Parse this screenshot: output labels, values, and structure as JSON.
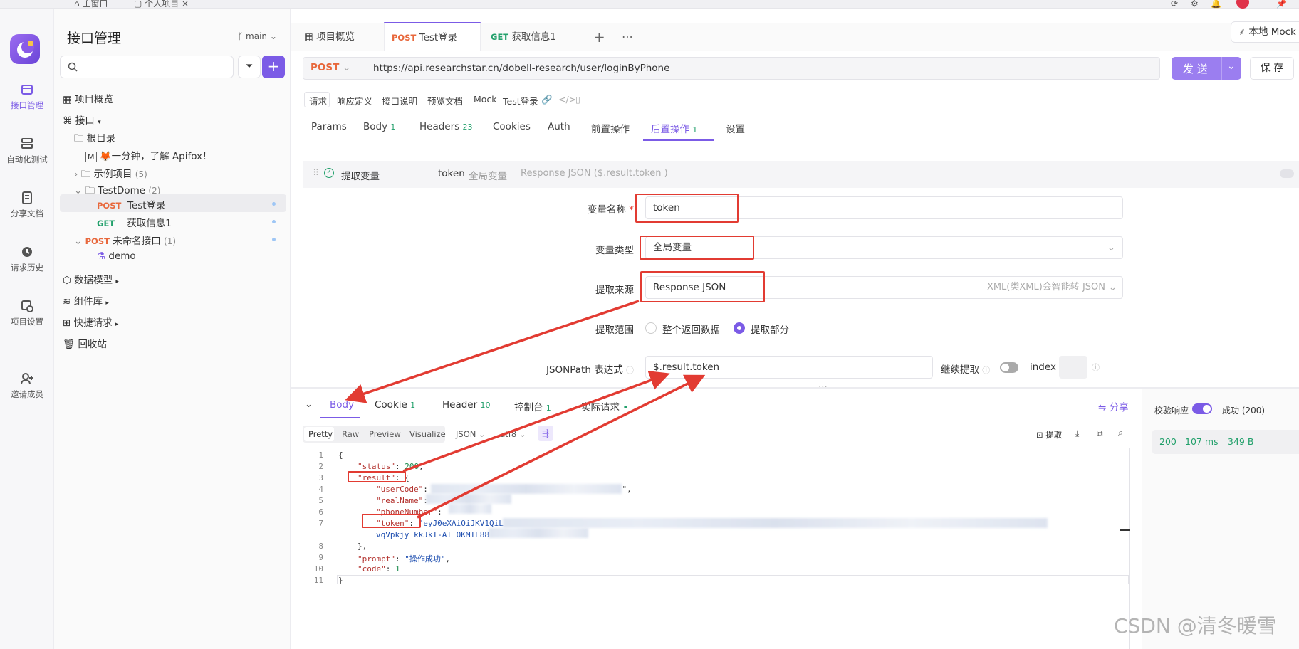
{
  "window": {
    "home_tab": "主窗口",
    "project_tab": "个人项目",
    "close": "×"
  },
  "rail": {
    "items": [
      {
        "label": "接口管理",
        "icon": "api-icon"
      },
      {
        "label": "自动化测试",
        "icon": "layers-icon"
      },
      {
        "label": "分享文档",
        "icon": "doc-share-icon"
      },
      {
        "label": "请求历史",
        "icon": "history-icon"
      },
      {
        "label": "项目设置",
        "icon": "settings-icon"
      },
      {
        "label": "邀请成员",
        "icon": "invite-icon"
      }
    ]
  },
  "sidebar": {
    "title": "接口管理",
    "branch": "main",
    "search_placeholder": "",
    "overview": "项目概览",
    "api": "接口",
    "root": "根目录",
    "intro": "🦊一分钟，了解 Apifox！",
    "examples": {
      "label": "示例项目",
      "count": "(5)"
    },
    "testdome": {
      "label": "TestDome",
      "count": "(2)"
    },
    "items": [
      {
        "method": "POST",
        "name": "Test登录"
      },
      {
        "method": "GET",
        "name": "获取信息1"
      }
    ],
    "unnamed": {
      "method": "POST",
      "label": "未命名接口",
      "count": "(1)"
    },
    "demo": "demo",
    "data_model": "数据模型",
    "components": "组件库",
    "quick_request": "快捷请求",
    "trash": "回收站"
  },
  "tabs": [
    {
      "label": "项目概览"
    },
    {
      "method": "POST",
      "label": "Test登录"
    },
    {
      "method": "GET",
      "label": "获取信息1"
    }
  ],
  "env": "本地 Mock",
  "request": {
    "method": "POST",
    "url": "https://api.researchstar.cn/dobell-research/user/loginByPhone",
    "send": "发 送",
    "save": "保 存"
  },
  "subtabs": [
    "请求",
    "响应定义",
    "接口说明",
    "预览文档",
    "Mock",
    "Test登录"
  ],
  "reqtabs": [
    {
      "label": "Params"
    },
    {
      "label": "Body",
      "count": "1"
    },
    {
      "label": "Headers",
      "count": "23"
    },
    {
      "label": "Cookies"
    },
    {
      "label": "Auth"
    },
    {
      "label": "前置操作"
    },
    {
      "label": "后置操作",
      "count": "1"
    },
    {
      "label": "设置"
    }
  ],
  "extract": {
    "title": "提取变量",
    "summary_var": "token",
    "summary_scope": "全局变量",
    "summary_source": "Response JSON ($.result.token )",
    "var_name_label": "变量名称",
    "var_name": "token",
    "var_type_label": "变量类型",
    "var_type": "全局变量",
    "source_label": "提取来源",
    "source": "Response JSON",
    "source_hint": "XML(类XML)会智能转 JSON",
    "range_label": "提取范围",
    "range_all": "整个返回数据",
    "range_part": "提取部分",
    "jsonpath_label": "JSONPath 表达式",
    "jsonpath": "$.result.token",
    "continue_label": "继续提取",
    "index_label": "index"
  },
  "response": {
    "tabs": [
      {
        "label": "Body"
      },
      {
        "label": "Cookie",
        "count": "1"
      },
      {
        "label": "Header",
        "count": "10"
      },
      {
        "label": "控制台",
        "count": "1"
      },
      {
        "label": "实际请求"
      }
    ],
    "share": "分享",
    "formats": [
      "Pretty",
      "Raw",
      "Preview",
      "Visualize"
    ],
    "format": "JSON",
    "encoding": "utf8",
    "extract_btn": "提取",
    "validate_label": "校验响应",
    "validate_result": "成功 (200)",
    "status": "200",
    "time": "107 ms",
    "size": "349 B"
  },
  "code": {
    "line_numbers": [
      "1",
      "2",
      "3",
      "4",
      "5",
      "6",
      "7",
      "8",
      "9",
      "10",
      "11"
    ],
    "brace_open": "{",
    "status_key": "\"status\"",
    "status_val": "200",
    "result_key": "\"result\"",
    "usercode_key": "\"userCode\"",
    "realname_key": "\"realName\"",
    "phone_key": "\"phoneNumber\"",
    "token_key": "\"token\"",
    "token_val_start": "\"eyJ0eXAiOiJKV1QiL",
    "token_val_cont": "vqVpkjy_kkJkI-AI_OKMIL88",
    "inner_close": "},",
    "prompt_key": "\"prompt\"",
    "prompt_val": "\"操作成功\"",
    "code_key": "\"code\"",
    "code_val": "1",
    "brace_close": "}"
  },
  "watermark": "CSDN @清冬暖雪",
  "colors": {
    "accent": "#7b5be6",
    "post": "#e8683c",
    "get": "#22a06b",
    "annotation": "#e23b32"
  }
}
